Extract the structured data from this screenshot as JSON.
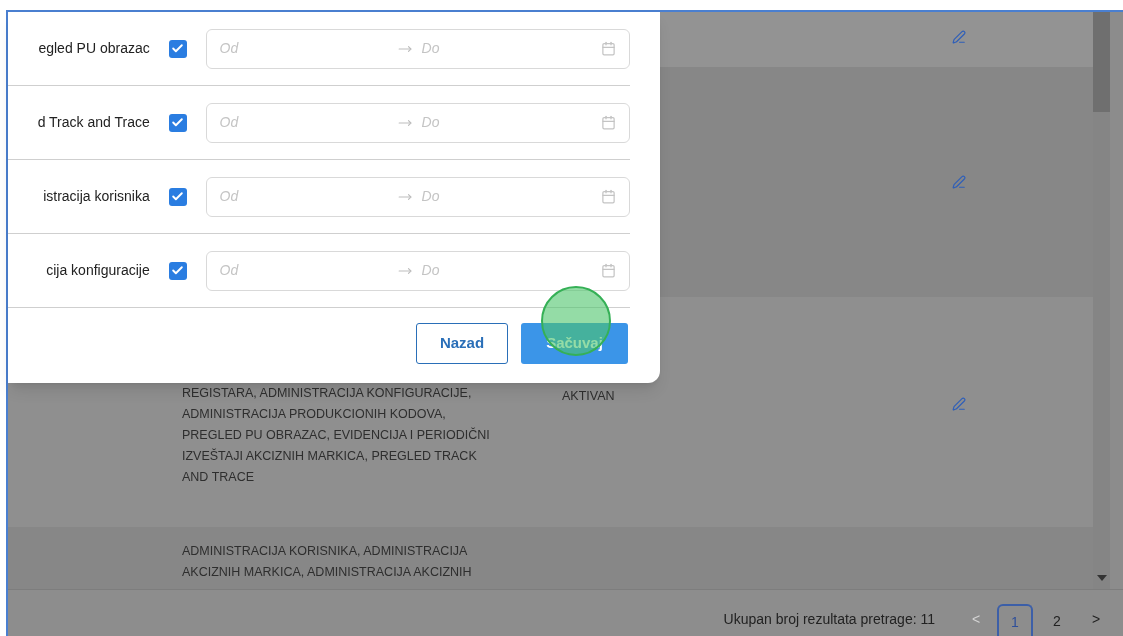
{
  "modal": {
    "rows": [
      {
        "label": "egled PU obrazac",
        "checked": true,
        "from_placeholder": "Od",
        "to_placeholder": "Do"
      },
      {
        "label": "d Track and Trace",
        "checked": true,
        "from_placeholder": "Od",
        "to_placeholder": "Do"
      },
      {
        "label": "istracija korisnika",
        "checked": true,
        "from_placeholder": "Od",
        "to_placeholder": "Do"
      },
      {
        "label": "cija konfiguracije",
        "checked": true,
        "from_placeholder": "Od",
        "to_placeholder": "Do"
      }
    ],
    "buttons": [
      {
        "label": "Nazad",
        "kind": "secondary"
      },
      {
        "label": "Sačuvaj",
        "kind": "primary"
      }
    ]
  },
  "table": {
    "rows": [
      {
        "editable": true
      },
      {
        "editable": true
      },
      {
        "roles": "REGISTARA, ADMINISTRACIJA KONFIGURACIJE, ADMINISTRACIJA PRODUKCIONIH KODOVA, PREGLED PU OBRAZAC, EVIDENCIJA I PERIODIČNI IZVEŠTAJI AKCIZNIH MARKICA, PREGLED TRACK AND TRACE",
        "status": "AKTIVAN",
        "editable": true
      },
      {
        "roles": "ADMINISTRACIJA KORISNIKA, ADMINISTRACIJA AKCIZNIH MARKICA, ADMINISTRACIJA AKCIZNIH"
      }
    ]
  },
  "pagination": {
    "total": "Ukupan broj rezultata pretrage: 11",
    "prev": "<",
    "prev_disabled": true,
    "pages": [
      {
        "label": "1",
        "selected": true
      },
      {
        "label": "2",
        "selected": false
      }
    ],
    "next": ">"
  }
}
